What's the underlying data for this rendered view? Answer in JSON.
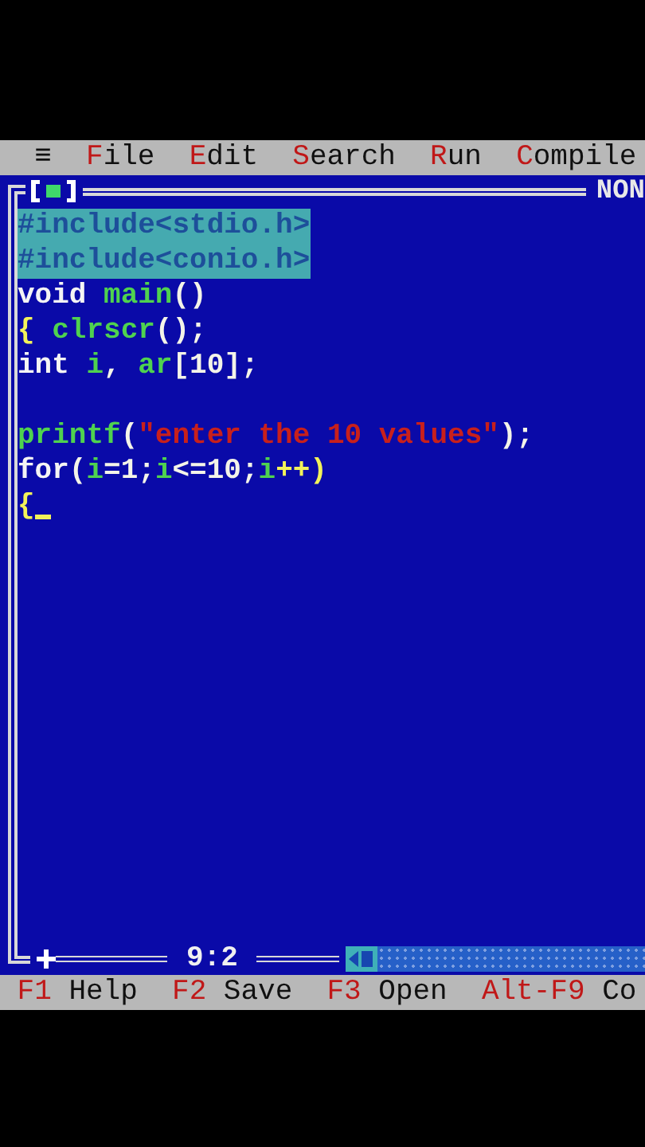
{
  "menu_bar": {
    "system_menu": "≡",
    "items": [
      {
        "hotkey": "F",
        "rest": "ile"
      },
      {
        "hotkey": "E",
        "rest": "dit"
      },
      {
        "hotkey": "S",
        "rest": "earch"
      },
      {
        "hotkey": "R",
        "rest": "un"
      },
      {
        "hotkey": "C",
        "rest": "ompile"
      }
    ]
  },
  "editor": {
    "mode": "NON",
    "position": "9:2",
    "lines": [
      {
        "selected": true,
        "tokens": [
          {
            "text": "#include<stdio.h>",
            "kind": "preprocessor"
          }
        ]
      },
      {
        "selected": true,
        "tokens": [
          {
            "text": "#include<conio.h>",
            "kind": "preprocessor"
          }
        ]
      },
      {
        "selected": false,
        "tokens": [
          {
            "text": "void ",
            "kind": "keyword"
          },
          {
            "text": "main",
            "kind": "identifier"
          },
          {
            "text": "()",
            "kind": "symbol"
          }
        ]
      },
      {
        "selected": false,
        "tokens": [
          {
            "text": "{ ",
            "kind": "brace"
          },
          {
            "text": "clrscr",
            "kind": "identifier"
          },
          {
            "text": "();",
            "kind": "symbol"
          }
        ]
      },
      {
        "selected": false,
        "tokens": [
          {
            "text": "int ",
            "kind": "keyword"
          },
          {
            "text": "i",
            "kind": "identifier"
          },
          {
            "text": ", ",
            "kind": "symbol"
          },
          {
            "text": "ar",
            "kind": "identifier"
          },
          {
            "text": "[10];",
            "kind": "symbol"
          }
        ]
      },
      {
        "selected": false
      },
      {
        "selected": false,
        "tokens": [
          {
            "text": "printf",
            "kind": "identifier"
          },
          {
            "text": "(",
            "kind": "symbol"
          },
          {
            "text": "\"enter the 10 values\"",
            "kind": "string"
          },
          {
            "text": ");",
            "kind": "symbol"
          }
        ]
      },
      {
        "selected": false,
        "tokens": [
          {
            "text": "for",
            "kind": "keyword"
          },
          {
            "text": "(",
            "kind": "symbol"
          },
          {
            "text": "i",
            "kind": "identifier"
          },
          {
            "text": "=1;",
            "kind": "symbol"
          },
          {
            "text": "i",
            "kind": "identifier"
          },
          {
            "text": "<=10;",
            "kind": "symbol"
          },
          {
            "text": "i",
            "kind": "identifier"
          },
          {
            "text": "++)",
            "kind": "brace"
          }
        ]
      },
      {
        "selected": false,
        "cursor": true,
        "tokens": [
          {
            "text": "{",
            "kind": "brace"
          }
        ]
      }
    ]
  },
  "status_bar": {
    "items": [
      {
        "key": "F1",
        "label": "Help"
      },
      {
        "key": "F2",
        "label": "Save"
      },
      {
        "key": "F3",
        "label": "Open"
      },
      {
        "key": "Alt-F9",
        "label": "Co"
      }
    ]
  }
}
